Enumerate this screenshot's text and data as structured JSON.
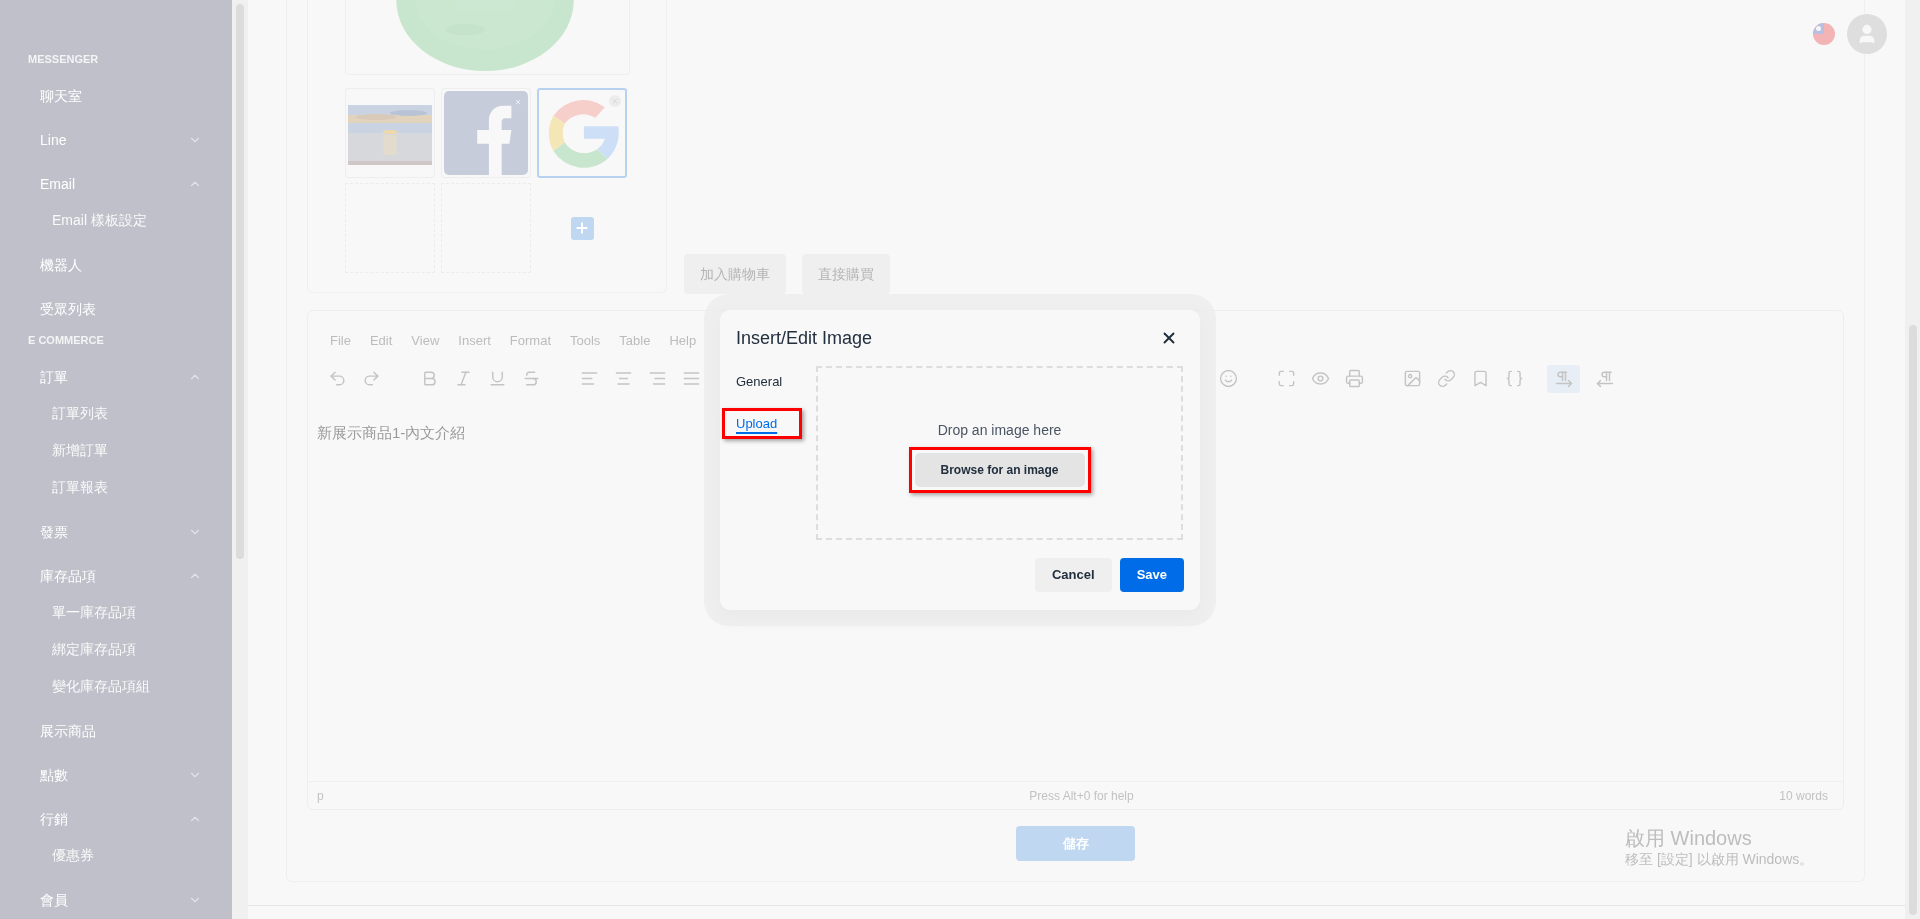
{
  "sidebar": {
    "sections": [
      {
        "heading": "MESSENGER",
        "items": [
          {
            "label": "聊天室"
          },
          {
            "label": "Line",
            "expanded": false
          },
          {
            "label": "Email",
            "expanded": true,
            "children": [
              {
                "label": "Email 樣板設定"
              }
            ]
          },
          {
            "label": "機器人"
          },
          {
            "label": "受眾列表"
          }
        ]
      },
      {
        "heading": "E COMMERCE",
        "items": [
          {
            "label": "訂單",
            "expanded": true,
            "children": [
              {
                "label": "訂單列表"
              },
              {
                "label": "新增訂單"
              },
              {
                "label": "訂單報表"
              }
            ]
          },
          {
            "label": "發票",
            "expanded": false
          },
          {
            "label": "庫存品項",
            "expanded": true,
            "children": [
              {
                "label": "單一庫存品項"
              },
              {
                "label": "綁定庫存品項"
              },
              {
                "label": "變化庫存品項組"
              }
            ]
          },
          {
            "label": "展示商品"
          },
          {
            "label": "點數",
            "expanded": false
          },
          {
            "label": "行銷",
            "expanded": true,
            "children": [
              {
                "label": "優惠券"
              }
            ]
          },
          {
            "label": "會員",
            "expanded": false
          }
        ]
      }
    ]
  },
  "gallery": {
    "thumbnails": [
      {
        "kind": "picture",
        "selected": false
      },
      {
        "kind": "f-logo",
        "selected": false
      },
      {
        "kind": "g-logo",
        "selected": true
      }
    ]
  },
  "product_buttons": [
    "加入購物車",
    "直接購買"
  ],
  "editor": {
    "menu": [
      "File",
      "Edit",
      "View",
      "Insert",
      "Format",
      "Tools",
      "Table",
      "Help"
    ],
    "direction_buttons": [
      {
        "active": true
      },
      {
        "active": false
      }
    ],
    "content": "新展示商品1-內文介紹",
    "status_path": "p",
    "help": "Press Alt+0 for help",
    "word_count": "10 words"
  },
  "save_button": "儲存",
  "dialog": {
    "title": "Insert/Edit Image",
    "tabs": [
      {
        "label": "General",
        "selected": false,
        "highlighted": false
      },
      {
        "label": "Upload",
        "selected": true,
        "highlighted": true
      }
    ],
    "drop_text": "Drop an image here",
    "browse_button": {
      "label": "Browse for an image",
      "highlighted": true
    },
    "buttons": [
      {
        "label": "Cancel",
        "kind": "secondary"
      },
      {
        "label": "Save",
        "kind": "primary"
      }
    ]
  },
  "activation_notice": {
    "title": "啟用 Windows",
    "text": "移至 [設定] 以啟用 Windows。"
  }
}
